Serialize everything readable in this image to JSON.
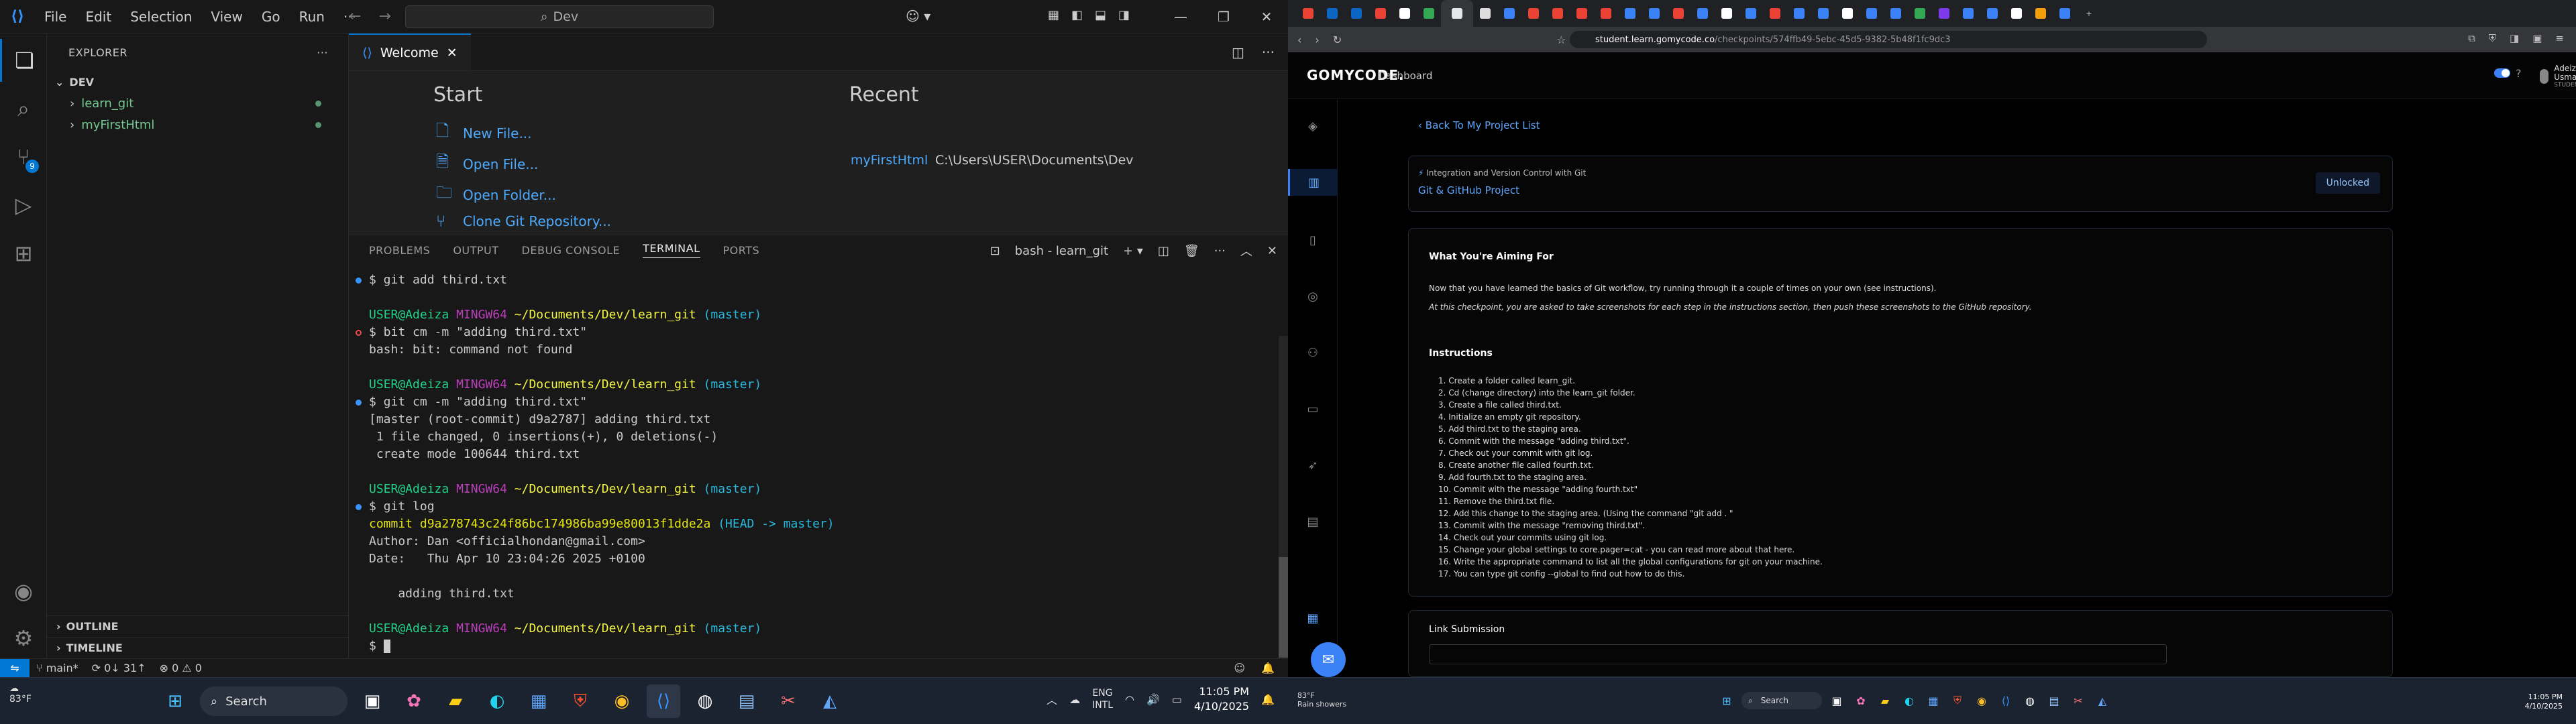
{
  "vscode": {
    "menu": [
      "File",
      "Edit",
      "Selection",
      "View",
      "Go",
      "Run"
    ],
    "more_menu": "···",
    "search_text": "Dev",
    "explorer": {
      "title": "EXPLORER",
      "more": "···",
      "root": "DEV",
      "items": [
        {
          "label": "learn_git"
        },
        {
          "label": "myFirstHtml"
        }
      ],
      "outline": "OUTLINE",
      "timeline": "TIMELINE"
    },
    "tab": {
      "label": "Welcome",
      "close": "✕"
    },
    "welcome": {
      "start_title": "Start",
      "recent_title": "Recent",
      "links": [
        "New File...",
        "Open File...",
        "Open Folder...",
        "Clone Git Repository..."
      ],
      "recent_name": "myFirstHtml",
      "recent_path": "C:\\Users\\USER\\Documents\\Dev"
    },
    "panel_tabs": [
      "PROBLEMS",
      "OUTPUT",
      "DEBUG CONSOLE",
      "TERMINAL",
      "PORTS"
    ],
    "terminal_label": "bash - learn_git",
    "terminal": {
      "l1_cmd": "$ git add third.txt",
      "prompt_user": "USER@Adeiza",
      "prompt_host": "MINGW64",
      "prompt_path": "~/Documents/Dev/learn_git",
      "prompt_branch": "(master)",
      "l2_cmd": "$ bit cm -m \"adding third.txt\"",
      "l2_out": "bash: bit: command not found",
      "l3_cmd": "$ git cm -m \"adding third.txt\"",
      "l3_out1": "[master (root-commit) d9a2787] adding third.txt",
      "l3_out2": " 1 file changed, 0 insertions(+), 0 deletions(-)",
      "l3_out3": " create mode 100644 third.txt",
      "l4_cmd": "$ git log",
      "commit_hash": "commit d9a278743c24f86bc174986ba99e80013f1dde2a",
      "commit_ref": "(HEAD -> master)",
      "author": "Author: Dan <officialhondan@gmail.com>",
      "date": "Date:   Thu Apr 10 23:04:26 2025 +0100",
      "message": "    adding third.txt",
      "last_prompt": "$ "
    },
    "status": {
      "branch": "main*",
      "sync": "0↓ 31↑",
      "problems": "⊗ 0 ⚠ 0"
    }
  },
  "browser": {
    "url_host": "student.learn.gomycode.co",
    "url_path": "/checkpoints/574ffb49-5ebc-45d5-9382-5b48f1fc9dc3",
    "brand": "GOMYCODE.",
    "nav_dashboard": "Dashboard",
    "user_name": "Adeiza Usman",
    "user_role": "STUDENT",
    "back_link": "Back To My Project List",
    "project_tag": "Integration and Version Control with Git",
    "project_name": "Git & GitHub Project",
    "unlock_label": "Unlocked",
    "aim_title": "What You're Aiming For",
    "aim_p1": "Now that you have learned the basics of Git workflow, try running through it a couple of times on your own (see instructions).",
    "aim_p2": "At this checkpoint, you are asked to take screenshots for each step in the instructions section, then push these screenshots to the GitHub repository.",
    "instructions_title": "Instructions",
    "instructions": [
      "1. Create a folder called learn_git.",
      "2. Cd (change directory) into the learn_git folder.",
      "3. Create a file called third.txt.",
      "4. Initialize an empty git repository.",
      "5. Add third.txt to the staging area.",
      "6. Commit with the message \"adding third.txt\".",
      "7. Check out your commit with git log.",
      "8. Create another file called fourth.txt.",
      "9. Add fourth.txt to the staging area.",
      "10. Commit with the message \"adding fourth.txt\"",
      "11. Remove the third.txt file.",
      "12. Add this change to the staging area. (Using the command \"git add . \"",
      "13. Commit with the message \"removing third.txt\".",
      "14. Check out your commits using git log.",
      "15. Change your global settings to core.pager=cat - you can read more about that here.",
      "16. Write the appropriate command to list all the global configurations for git on your machine.",
      "17. You can type git config --global to find out how to do this."
    ],
    "link_submission": "Link Submission"
  },
  "taskbar_left": {
    "weather_temp": "83°F",
    "search_label": "Search",
    "lang1": "ENG",
    "lang2": "INTL",
    "time": "11:05 PM",
    "date": "4/10/2025"
  },
  "taskbar_right": {
    "weather_temp": "83°F",
    "weather_desc": "Rain showers",
    "search_label": "Search",
    "time": "11:05 PM",
    "date": "4/10/2025"
  },
  "colors": {
    "vscode_accent": "#0078d4",
    "terminal_green": "#23d18b",
    "terminal_magenta": "#bc3fbc",
    "terminal_yellow": "#f5f543",
    "terminal_cyan": "#29b8db",
    "gomycode_blue": "#3b82f6"
  }
}
